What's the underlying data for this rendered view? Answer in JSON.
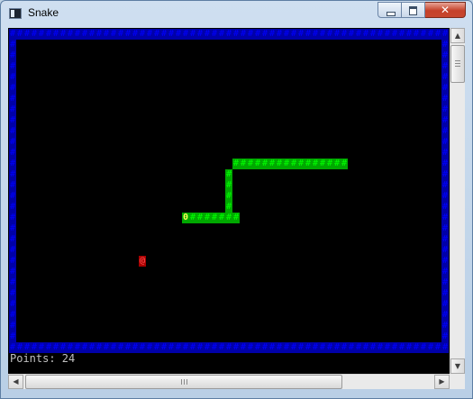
{
  "window": {
    "title": "Snake",
    "close_glyph": "✕"
  },
  "game": {
    "points_text": "Points: 24",
    "border_glyph": "#",
    "snake_body_glyph": "#",
    "snake_head_glyph": "0",
    "food_glyph": "@",
    "grid": {
      "cols": 61,
      "rows": 30
    },
    "snake": {
      "head": [
        24,
        17
      ],
      "body": [
        [
          25,
          17
        ],
        [
          26,
          17
        ],
        [
          27,
          17
        ],
        [
          28,
          17
        ],
        [
          29,
          17
        ],
        [
          30,
          17
        ],
        [
          31,
          17
        ],
        [
          30,
          16
        ],
        [
          30,
          15
        ],
        [
          30,
          14
        ],
        [
          30,
          13
        ],
        [
          31,
          12
        ],
        [
          32,
          12
        ],
        [
          33,
          12
        ],
        [
          34,
          12
        ],
        [
          35,
          12
        ],
        [
          36,
          12
        ],
        [
          37,
          12
        ],
        [
          38,
          12
        ],
        [
          39,
          12
        ],
        [
          40,
          12
        ],
        [
          41,
          12
        ],
        [
          42,
          12
        ],
        [
          43,
          12
        ],
        [
          44,
          12
        ],
        [
          45,
          12
        ],
        [
          46,
          12
        ]
      ],
      "corner_cells": [
        [
          30,
          17
        ],
        [
          30,
          12
        ]
      ]
    },
    "food": [
      18,
      21
    ],
    "colors": {
      "background": "#000000",
      "wall": "#0000a8",
      "snake": "#00a800",
      "snake_head": "#ffff55",
      "food": "#a80000",
      "text": "#c0c0c0"
    }
  },
  "scrollbars": {
    "up_arrow": "▲",
    "down_arrow": "▼",
    "left_arrow": "◀",
    "right_arrow": "▶"
  },
  "icons": {
    "app": "console-window-icon",
    "minimize": "minimize-icon",
    "maximize": "maximize-icon",
    "close": "close-icon"
  }
}
